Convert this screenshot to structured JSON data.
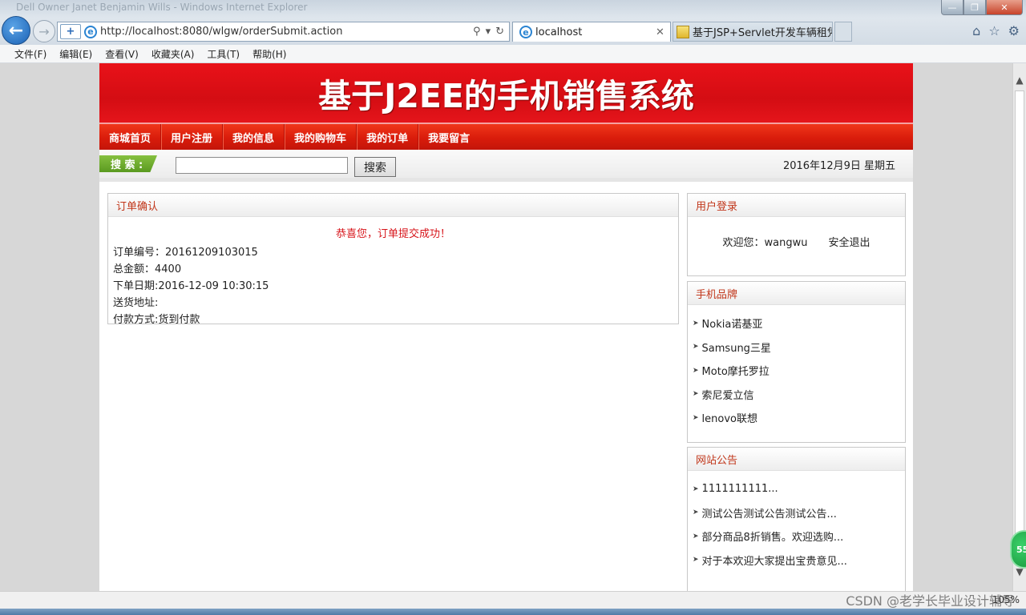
{
  "browser": {
    "window_title": "Dell Owner Janet Benjamin Wills - Windows Internet Explorer",
    "address": "http://localhost:8080/wlgw/orderSubmit.action",
    "tabs": [
      {
        "label": "localhost"
      },
      {
        "label": "基于JSP+Servlet开发车辆租凭..."
      }
    ],
    "menu": [
      "文件(F)",
      "编辑(E)",
      "查看(V)",
      "收藏夹(A)",
      "工具(T)",
      "帮助(H)"
    ],
    "zoom": "105%"
  },
  "site": {
    "title": "基于J2EE的手机销售系统",
    "nav": [
      "商城首页",
      "用户注册",
      "我的信息",
      "我的购物车",
      "我的订单",
      "我要留言"
    ],
    "search_label": "搜 索 :",
    "search_button": "搜索",
    "search_value": "",
    "date": "2016年12月9日 星期五"
  },
  "order": {
    "heading": "订单确认",
    "success": "恭喜您，订单提交成功！",
    "lines": [
      "订单编号：20161209103015",
      "总金额：4400",
      "下单日期:2016-12-09 10:30:15",
      "送货地址:",
      "付款方式:货到付款"
    ]
  },
  "login": {
    "heading": "用户登录",
    "welcome": "欢迎您：wangwu",
    "logout": "安全退出"
  },
  "brands": {
    "heading": "手机品牌",
    "items": [
      "Nokia诺基亚",
      "Samsung三星",
      "Moto摩托罗拉",
      "索尼爱立信",
      "lenovo联想"
    ]
  },
  "notices": {
    "heading": "网站公告",
    "items": [
      "1111111111...",
      "测试公告测试公告测试公告...",
      "部分商品8折销售。欢迎选购...",
      "对于本欢迎大家提出宝贵意见..."
    ]
  },
  "overlay": {
    "badge": "55",
    "watermark": "CSDN @老学长毕业设计辅导"
  },
  "colors": {
    "brand_red": "#d40d13",
    "accent_text": "#c1361a",
    "search_green": "#6aaa2a"
  }
}
